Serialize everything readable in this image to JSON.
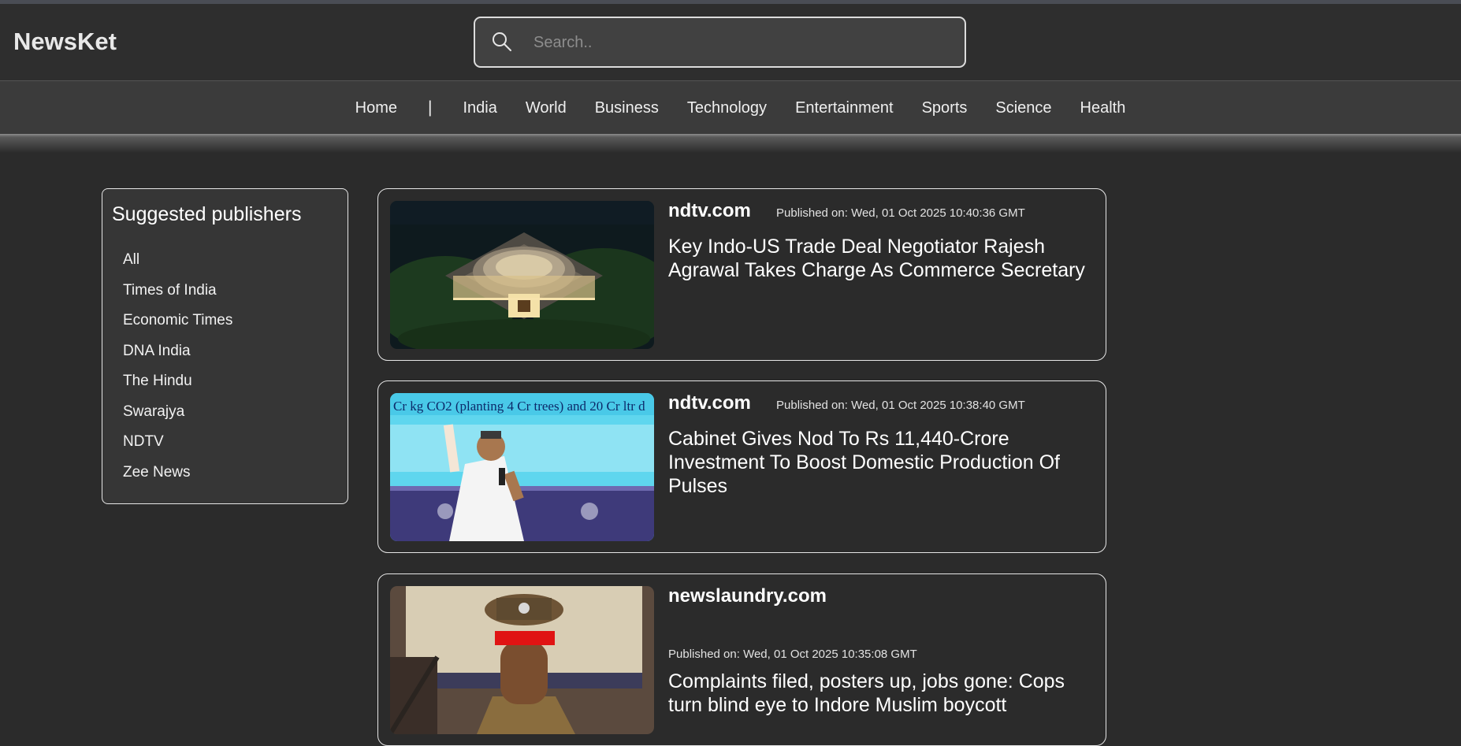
{
  "header": {
    "logo": "NewsKet",
    "search_placeholder": "Search.."
  },
  "nav": {
    "items": [
      "Home",
      "India",
      "World",
      "Business",
      "Technology",
      "Entertainment",
      "Sports",
      "Science",
      "Health"
    ],
    "separator": "|"
  },
  "sidebar": {
    "title": "Suggested publishers",
    "publishers": [
      "All",
      "Times of India",
      "Economic Times",
      "DNA India",
      "The Hindu",
      "Swarajya",
      "NDTV",
      "Zee News"
    ]
  },
  "articles": [
    {
      "source": "ndtv.com",
      "published": "Published on: Wed, 01 Oct 2025 10:40:36 GMT",
      "headline": "Key Indo-US Trade Deal Negotiator Rajesh Agrawal Takes Charge As Commerce Secretary"
    },
    {
      "source": "ndtv.com",
      "published": "Published on: Wed, 01 Oct 2025 10:38:40 GMT",
      "headline": "Cabinet Gives Nod To Rs 11,440-Crore Investment To Boost Domestic Production Of Pulses",
      "image_text": "Cr kg CO2 (planting 4 Cr trees) and 20 Cr ltr d"
    },
    {
      "source": "newslaundry.com",
      "published": "Published on: Wed, 01 Oct 2025 10:35:08 GMT",
      "headline": "Complaints filed, posters up, jobs gone: Cops turn blind eye to Indore Muslim boycott"
    }
  ],
  "colors": {
    "page_bg": "#2b2b2b",
    "header_bg": "#2e2e2e",
    "nav_bg": "#3b3b3b",
    "sidebar_bg": "#363636",
    "border": "#e6e6e6"
  },
  "icons": {
    "search": "search-icon"
  }
}
